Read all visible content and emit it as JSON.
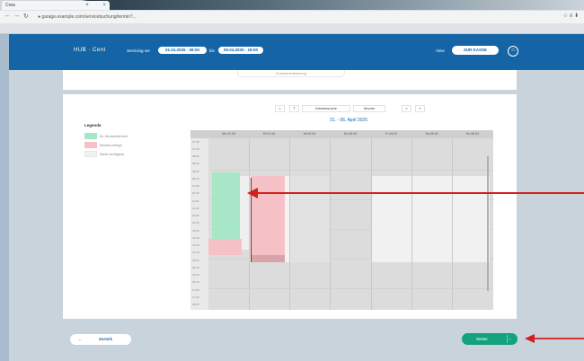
{
  "browser": {
    "tab_title": "Crea",
    "url": "● garage.example.com/servicebuchung/termin?...",
    "toolbar_right": "☆ ≡ ⬇"
  },
  "app": {
    "title": "HUB · Cent",
    "period_label": "Servicing ver",
    "date_from": "01.04.2025 · 08:00",
    "date_to_label": "bis",
    "date_to": "05.04.2025 · 18:00",
    "view_label": "View",
    "view_value": "ZUR KASSE",
    "top_chip": "Zusammenfassung"
  },
  "calendar": {
    "nav_prev": "<",
    "nav_today": "T",
    "nav_workweek": "Arbeitswoche",
    "nav_week": "Woche",
    "nav_next": ">",
    "nav_end": "»",
    "range": "31. - 06. April 2025",
    "days": [
      "Mo 31.03",
      "Di 01.04",
      "Mi 02.04",
      "Do 03.04",
      "Fr 04.04",
      "Sa 05.04",
      "So 06.04"
    ],
    "times": [
      "07:00",
      "07:30",
      "08:00",
      "08:30",
      "09:00",
      "09:30",
      "10:00",
      "10:30",
      "11:00",
      "11:30",
      "12:00",
      "12:30",
      "13:00",
      "13:30",
      "14:00",
      "14:30",
      "15:00",
      "15:30",
      "16:00",
      "16:30",
      "17:00",
      "17:30",
      "18:00"
    ]
  },
  "legend": {
    "title": "Legende",
    "items": [
      {
        "label": "Ihr Wunschtermin",
        "color": "#a8e6c8"
      },
      {
        "label": "Bereits belegt",
        "color": "#f6c1c6"
      },
      {
        "label": "Nicht verfügbar",
        "color": "#f2f2f2"
      }
    ]
  },
  "footer": {
    "back_icon": "←",
    "back_label": "Zurück",
    "next_label": "Weiter",
    "next_icon": "›"
  },
  "colors": {
    "primary": "#1565a6",
    "accent": "#12a37c",
    "annotation": "#d0211c",
    "event_selected": "#a8e6c8",
    "event_busy": "#f6c1c6"
  }
}
